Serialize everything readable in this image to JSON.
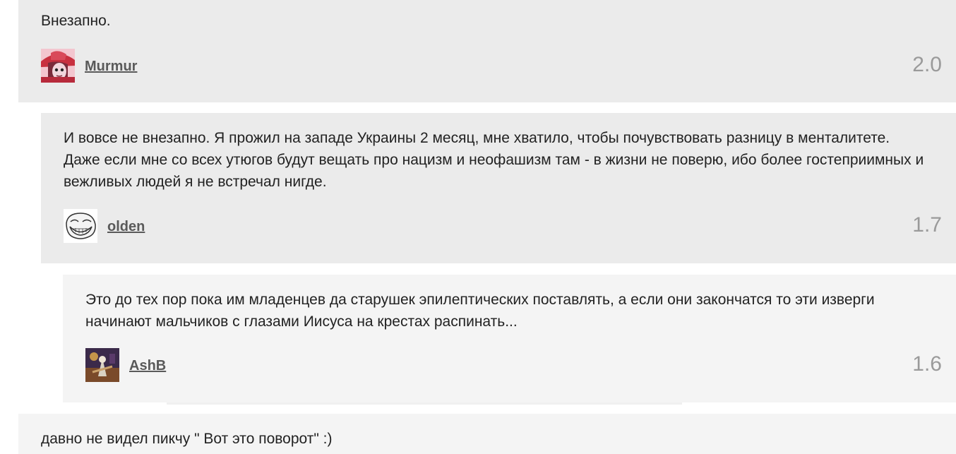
{
  "comments": [
    {
      "text": "Внезапно.",
      "author": "Murmur",
      "rating": "2.0",
      "avatar_icon": "murmur-avatar-icon"
    },
    {
      "text": "И вовсе не внезапно. Я прожил на западе Украины 2 месяц, мне хватило, чтобы почувствовать разницу в менталитете. Даже если мне со всех утюгов будут вещать про нацизм и неофашизм там - в жизни не поверю, ибо более гостеприимных и вежливых людей я не встречал нигде.",
      "author": "olden",
      "rating": "1.7",
      "avatar_icon": "trollface-avatar-icon"
    },
    {
      "text": "Это до тех пор пока им младенцев да старушек эпилептических поставлять, а если они закончатся то эти изверги начинают мальчиков с глазами Иисуса на крестах распинать...",
      "author": "AshB",
      "rating": "1.6",
      "avatar_icon": "ashb-avatar-icon"
    },
    {
      "text": "давно не видел пикчу \" Вот это поворот\" :)"
    }
  ]
}
